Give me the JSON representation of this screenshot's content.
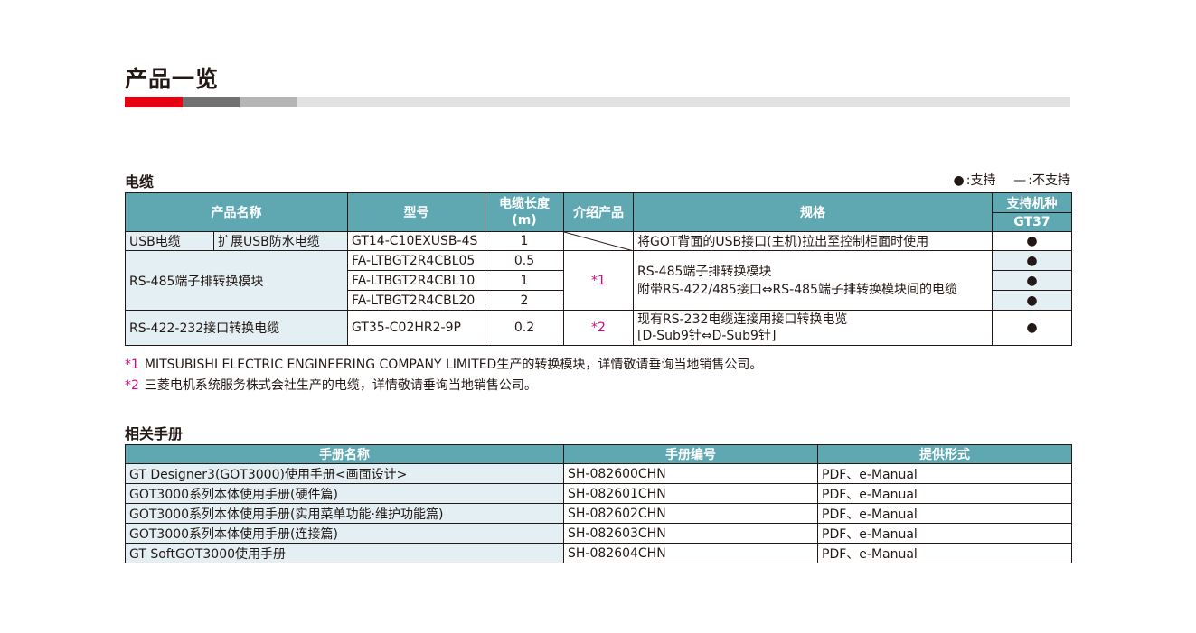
{
  "page": {
    "title": "产品一览"
  },
  "cable_section": {
    "title": "电缆",
    "legend": {
      "supported_symbol": "●",
      "supported_label": ":支持",
      "unsupported_symbol": "—",
      "unsupported_label": ":不支持"
    },
    "headers": {
      "product_name": "产品名称",
      "model": "型号",
      "length_line1": "电缆长度",
      "length_line2": "(m)",
      "intro": "介绍产品",
      "spec": "规格",
      "support": "支持机种",
      "support_model": "GT37"
    },
    "rows": {
      "usb": {
        "category": "USB电缆",
        "name": "扩展USB防水电缆",
        "model": "GT14-C10EXUSB-4S",
        "length": "1",
        "spec": "将GOT背面的USB接口(主机)拉出至控制柜面时使用",
        "support": "●"
      },
      "rs485": {
        "name": "RS-485端子排转换模块",
        "intro": "*1",
        "spec_line1": "RS-485端子排转换模块",
        "spec_line2": "附带RS-422/485接口⇔RS-485端子排转换模块间的电缆",
        "items": [
          {
            "model": "FA-LTBGT2R4CBL05",
            "length": "0.5",
            "support": "●"
          },
          {
            "model": "FA-LTBGT2R4CBL10",
            "length": "1",
            "support": "●"
          },
          {
            "model": "FA-LTBGT2R4CBL20",
            "length": "2",
            "support": "●"
          }
        ]
      },
      "rs422": {
        "name": "RS-422-232接口转换电缆",
        "model": "GT35-C02HR2-9P",
        "length": "0.2",
        "intro": "*2",
        "spec_line1": "现有RS-232电缆连接用接口转换电览",
        "spec_line2": "[D-Sub9针⇔D-Sub9针]",
        "support": "●"
      }
    },
    "notes": [
      {
        "mark": "*1",
        "text": "MITSUBISHI ELECTRIC ENGINEERING COMPANY LIMITED生产的转换模块，详情敬请垂询当地销售公司。"
      },
      {
        "mark": "*2",
        "text": "三菱电机系统服务株式会社生产的电缆，详情敬请垂询当地销售公司。"
      }
    ]
  },
  "manual_section": {
    "title": "相关手册",
    "headers": {
      "name": "手册名称",
      "number": "手册编号",
      "format": "提供形式"
    },
    "rows": [
      {
        "name": "GT Designer3(GOT3000)使用手册<画面设计>",
        "number": "SH-082600CHN",
        "format": "PDF、e-Manual"
      },
      {
        "name": "GOT3000系列本体使用手册(硬件篇)",
        "number": "SH-082601CHN",
        "format": "PDF、e-Manual"
      },
      {
        "name": "GOT3000系列本体使用手册(实用菜单功能·维护功能篇)",
        "number": "SH-082602CHN",
        "format": "PDF、e-Manual"
      },
      {
        "name": "GOT3000系列本体使用手册(连接篇)",
        "number": "SH-082603CHN",
        "format": "PDF、e-Manual"
      },
      {
        "name": "GT SoftGOT3000使用手册",
        "number": "SH-082604CHN",
        "format": "PDF、e-Manual"
      }
    ]
  }
}
